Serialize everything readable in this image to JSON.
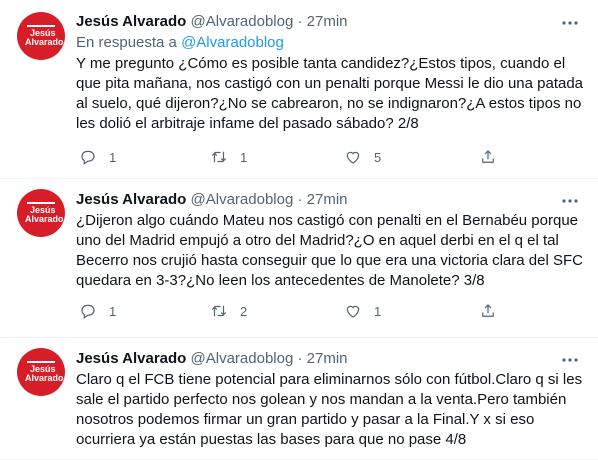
{
  "tweets": [
    {
      "author_name": "Jesús Alvarado",
      "handle": "@Alvaradoblog",
      "separator": "·",
      "time": "27min",
      "reply_prefix": "En respuesta a",
      "reply_handle": "@Alvaradoblog",
      "text": "Y me pregunto ¿Cómo es posible tanta candidez?¿Estos tipos, cuando el que pita mañana, nos castigó con un penalti porque Messi le dio una patada al suelo, qué dijeron?¿No se cabrearon, no se indignaron?¿A estos tipos no les dolió el arbitraje infame del pasado sábado? 2/8",
      "reply_count": "1",
      "retweet_count": "1",
      "like_count": "5"
    },
    {
      "author_name": "Jesús Alvarado",
      "handle": "@Alvaradoblog",
      "separator": "·",
      "time": "27min",
      "text": "¿Dijeron algo cuándo Mateu nos castigó con penalti en el Bernabéu porque uno del Madrid empujó a otro del Madrid?¿O en aquel derbi en el q el tal Becerro nos crujió hasta conseguir que lo que era una victoria clara del SFC quedara en 3-3?¿No leen los antecedentes de Manolete? 3/8",
      "reply_count": "1",
      "retweet_count": "2",
      "like_count": "1"
    },
    {
      "author_name": "Jesús Alvarado",
      "handle": "@Alvaradoblog",
      "separator": "·",
      "time": "27min",
      "text": "Claro q el FCB tiene potencial para eliminarnos sólo con fútbol.Claro q si les sale el partido perfecto nos golean y nos mandan a la venta.Pero también nosotros podemos firmar un gran partido y pasar a la Final.Y x si eso ocurriera ya están puestas las bases para que no pase 4/8"
    }
  ],
  "avatar_logo": {
    "line1": "Jesús",
    "line2": "Alvarado"
  },
  "icons": {
    "more": "more-horizontal-icon",
    "reply": "reply-bubble-icon",
    "retweet": "retweet-icon",
    "like": "heart-icon",
    "share": "share-icon"
  },
  "colors": {
    "text": "#0f1419",
    "secondary": "#536471",
    "link": "#1d9bf0",
    "avatar_bg": "#d71e28",
    "divider": "#eff3f4"
  }
}
